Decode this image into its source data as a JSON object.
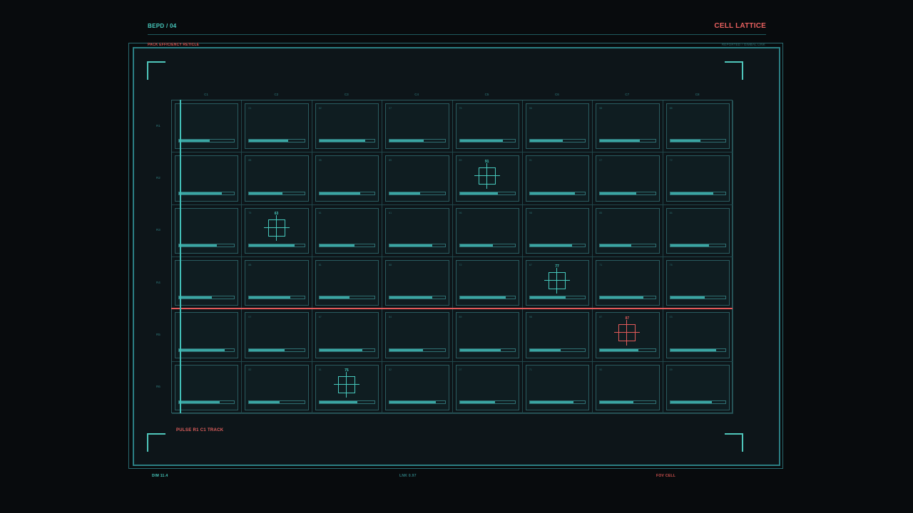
{
  "header": {
    "id": "BEPD / 04",
    "title": "CELL LATTICE"
  },
  "panel": {
    "subtitle_left": "PACK EFFICIENCY RETICLE",
    "subtitle_right": "REPORTED / GIMBAL LINK"
  },
  "lattice": {
    "columns": [
      "C1",
      "C2",
      "C3",
      "C4",
      "C5",
      "C6",
      "C7",
      "C8"
    ],
    "rows": [
      "R1",
      "R2",
      "R3",
      "R4",
      "R5",
      "R6"
    ],
    "cells": [
      [
        {
          "id": "",
          "fill": 0.55
        },
        {
          "id": "01",
          "fill": 0.7
        },
        {
          "id": "82",
          "fill": 0.83
        },
        {
          "id": "07",
          "fill": 0.62
        },
        {
          "id": "75",
          "fill": 0.78
        },
        {
          "id": "96",
          "fill": 0.6
        },
        {
          "id": "98",
          "fill": 0.72
        },
        {
          "id": "88",
          "fill": 0.55
        }
      ],
      [
        {
          "id": "",
          "fill": 0.78
        },
        {
          "id": "88",
          "fill": 0.6
        },
        {
          "id": "95",
          "fill": 0.74
        },
        {
          "id": "85",
          "fill": 0.55
        },
        {
          "id": "89",
          "fill": 0.69
        },
        {
          "id": "01",
          "fill": 0.82
        },
        {
          "id": "07",
          "fill": 0.65
        },
        {
          "id": "72",
          "fill": 0.78
        }
      ],
      [
        {
          "id": "",
          "fill": 0.68
        },
        {
          "id": "75",
          "fill": 0.82
        },
        {
          "id": "61",
          "fill": 0.64
        },
        {
          "id": "61",
          "fill": 0.78
        },
        {
          "id": "96",
          "fill": 0.6
        },
        {
          "id": "98",
          "fill": 0.76
        },
        {
          "id": "85",
          "fill": 0.56
        },
        {
          "id": "84",
          "fill": 0.7
        }
      ],
      [
        {
          "id": "",
          "fill": 0.6
        },
        {
          "id": "88",
          "fill": 0.74
        },
        {
          "id": "81",
          "fill": 0.55
        },
        {
          "id": "88",
          "fill": 0.77
        },
        {
          "id": "72",
          "fill": 0.84
        },
        {
          "id": "67",
          "fill": 0.65
        },
        {
          "id": "71",
          "fill": 0.79
        },
        {
          "id": "75",
          "fill": 0.62
        }
      ],
      [
        {
          "id": "",
          "fill": 0.83
        },
        {
          "id": "07",
          "fill": 0.64
        },
        {
          "id": "67",
          "fill": 0.78
        },
        {
          "id": "84",
          "fill": 0.6
        },
        {
          "id": "89",
          "fill": 0.74
        },
        {
          "id": "98",
          "fill": 0.56
        },
        {
          "id": "87",
          "fill": 0.69
        },
        {
          "id": "03",
          "fill": 0.83
        }
      ],
      [
        {
          "id": "",
          "fill": 0.74
        },
        {
          "id": "82",
          "fill": 0.55
        },
        {
          "id": "61",
          "fill": 0.69
        },
        {
          "id": "82",
          "fill": 0.84
        },
        {
          "id": "07",
          "fill": 0.64
        },
        {
          "id": "71",
          "fill": 0.79
        },
        {
          "id": "90",
          "fill": 0.6
        },
        {
          "id": "09",
          "fill": 0.76
        }
      ]
    ]
  },
  "reticles": [
    {
      "label": "91",
      "row": 1,
      "col": 4,
      "state": "ok"
    },
    {
      "label": "63",
      "row": 2,
      "col": 1,
      "state": "ok"
    },
    {
      "label": "77",
      "row": 3,
      "col": 5,
      "state": "ok"
    },
    {
      "label": "87",
      "row": 4,
      "col": 6,
      "state": "alert"
    },
    {
      "label": "75",
      "row": 5,
      "col": 2,
      "state": "ok"
    }
  ],
  "status": {
    "pulse": "PULSE R1 C1 TRACK"
  },
  "footer": {
    "dim": "DIM 11.4",
    "lnk": "LNK 0.97",
    "fov": "FOV CELL"
  },
  "colors": {
    "accent": "#47c9bd",
    "alert": "#e25a5a",
    "frame": "#2b7f84"
  }
}
